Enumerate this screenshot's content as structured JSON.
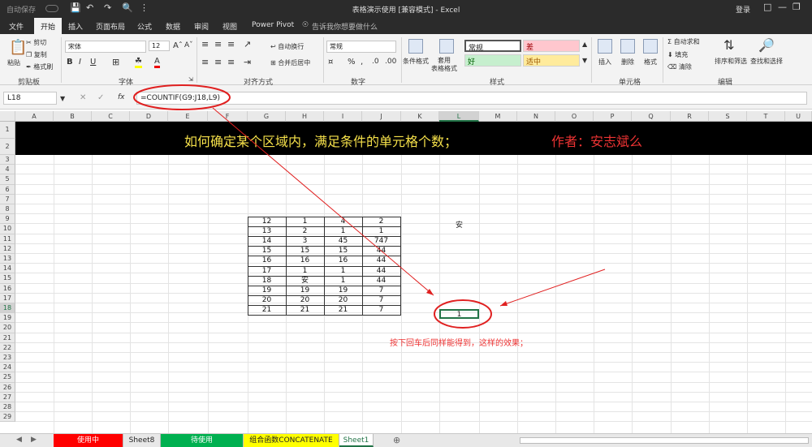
{
  "titlebar": {
    "autosave": "自动保存",
    "doc_title": "表格演示使用 [兼容模式] - Excel",
    "login": "登录"
  },
  "tabs": [
    "文件",
    "开始",
    "插入",
    "页面布局",
    "公式",
    "数据",
    "审阅",
    "视图",
    "Power Pivot"
  ],
  "tell_me": "告诉我你想要做什么",
  "ribbon": {
    "clipboard": {
      "paste": "粘贴",
      "cut": "剪切",
      "copy": "复制",
      "format_painter": "格式刷",
      "label": "剪贴板"
    },
    "font": {
      "name": "宋体",
      "size": "12",
      "label": "字体"
    },
    "alignment": {
      "wrap": "自动换行",
      "merge": "合并后居中",
      "label": "对齐方式"
    },
    "number": {
      "format": "常规",
      "label": "数字"
    },
    "styles": {
      "cond_format": "条件格式",
      "table_format": "套用\n表格格式",
      "normal": "常规",
      "bad": "差",
      "good": "好",
      "neutral": "适中",
      "label": "样式"
    },
    "cells": {
      "insert": "插入",
      "delete": "删除",
      "format": "格式",
      "label": "单元格"
    },
    "editing": {
      "autosum": "自动求和",
      "fill": "填充",
      "clear": "清除",
      "sort": "排序和筛选",
      "find": "查找和选择",
      "label": "编辑"
    }
  },
  "formula_bar": {
    "name_box": "L18",
    "fx": "fx",
    "formula": "=COUNTIF(G9:J18,L9)"
  },
  "columns": [
    "A",
    "B",
    "C",
    "D",
    "E",
    "F",
    "G",
    "H",
    "I",
    "J",
    "K",
    "L",
    "M",
    "N",
    "O",
    "P",
    "Q",
    "R",
    "S",
    "T",
    "U"
  ],
  "rows": [
    "1",
    "2",
    "3",
    "4",
    "5",
    "6",
    "7",
    "8",
    "9",
    "10",
    "11",
    "12",
    "13",
    "14",
    "15",
    "16",
    "17",
    "18",
    "19",
    "20",
    "21",
    "22",
    "23",
    "24",
    "25",
    "26",
    "27",
    "28",
    "29"
  ],
  "banner": {
    "title": "如何确定某个区域内，满足条件的单元格个数；",
    "author": "作者：安志斌么"
  },
  "table": [
    [
      "12",
      "1",
      "4",
      "2"
    ],
    [
      "13",
      "2",
      "1",
      "1"
    ],
    [
      "14",
      "3",
      "45",
      "747"
    ],
    [
      "15",
      "15",
      "15",
      "44"
    ],
    [
      "16",
      "16",
      "16",
      "44"
    ],
    [
      "17",
      "1",
      "1",
      "44"
    ],
    [
      "18",
      "安",
      "1",
      "44"
    ],
    [
      "19",
      "19",
      "19",
      "7"
    ],
    [
      "20",
      "20",
      "20",
      "7"
    ],
    [
      "21",
      "21",
      "21",
      "7"
    ]
  ],
  "criteria_cell": "安",
  "result_cell": "1",
  "note": "按下回车后同样能得到，这样的效果；",
  "sheets": [
    {
      "name": "使用中",
      "color": "#ff0000",
      "text": "#ffffff"
    },
    {
      "name": "Sheet8",
      "color": "#e8e8e8",
      "text": "#222222"
    },
    {
      "name": "待使用",
      "color": "#00b050",
      "text": "#ffffff"
    },
    {
      "name": "组合函数CONCATENATE",
      "color": "#ffff00",
      "text": "#222222"
    },
    {
      "name": "Sheet1",
      "color": "#ffffff",
      "text": "#217346"
    }
  ],
  "colors": {
    "accent": "#217346",
    "annotation": "#e02020"
  }
}
